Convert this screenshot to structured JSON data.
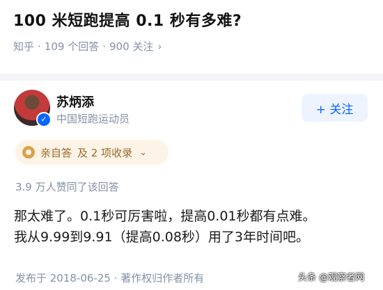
{
  "question": {
    "title": "100 米短跑提高 0.1 秒有多难?",
    "source": "知乎",
    "answers_count": "109 个回答",
    "followers_count": "900 关注",
    "chevron": "›"
  },
  "author": {
    "name": "苏炳添",
    "description": "中国短跑运动员",
    "verified_icon": "checkmark-icon",
    "follow_label": "+ 关注"
  },
  "badge": {
    "label": "亲自答",
    "collections": "及 2 项收录",
    "chevron": "⌄"
  },
  "votes": "3.9 万人赞同了该回答",
  "answer_lines": [
    "那太难了。0.1秒可厉害啦，提高0.01秒都有点难。",
    "我从9.99到9.91（提高0.08秒）用了3年时间吧。"
  ],
  "footer": {
    "published": "发布于 2018-06-25 · 著作权归作者所有"
  },
  "watermark": "头条 @观察者网",
  "colors": {
    "accent": "#0a66ff",
    "meta": "#8590a6",
    "badge_text": "#9a6b2a",
    "badge_bg": "#fdf4e7"
  }
}
